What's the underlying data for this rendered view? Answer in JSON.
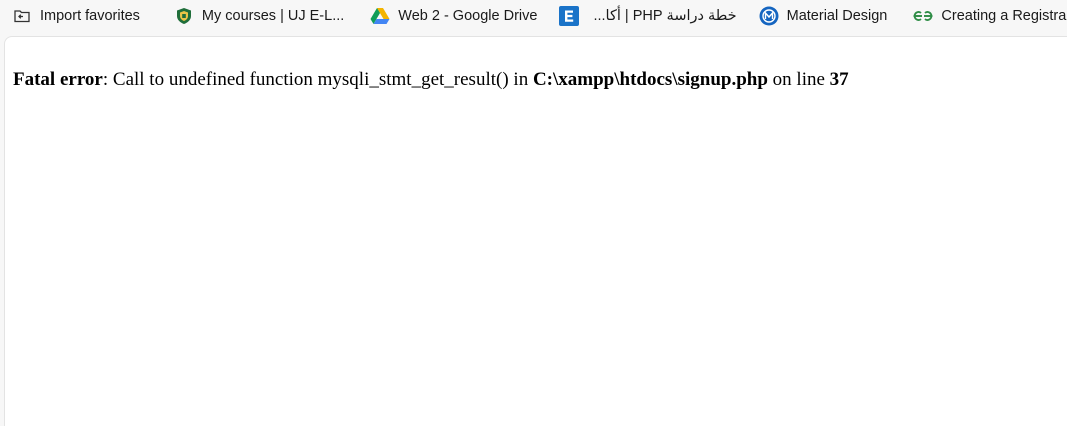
{
  "bookmarks": [
    {
      "label": "Import favorites",
      "icon": "import-favorites-icon"
    },
    {
      "label": "My courses | UJ E-L...",
      "icon": "uj-shield-icon"
    },
    {
      "label": "Web 2 - Google Drive",
      "icon": "google-drive-icon"
    },
    {
      "label": "خطة دراسة PHP | أكا...",
      "icon": "e-letter-icon"
    },
    {
      "label": "Material Design",
      "icon": "material-design-icon"
    },
    {
      "label": "Creating a Registra",
      "icon": "geeksforgeeks-icon"
    }
  ],
  "error": {
    "label": "Fatal error",
    "sep": ": ",
    "message": "Call to undefined function mysqli_stmt_get_result() in ",
    "file": "C:\\xampp\\htdocs\\signup.php",
    "on_line_text": " on line ",
    "line": "37"
  },
  "colors": {
    "drive_green": "#0f9d58",
    "drive_yellow": "#f4b400",
    "drive_blue": "#4285f4",
    "uj_green": "#1f6e3a",
    "e_icon_blue": "#1a73c8",
    "material_blue": "#1565c0",
    "gfg_green": "#2f8d46"
  }
}
